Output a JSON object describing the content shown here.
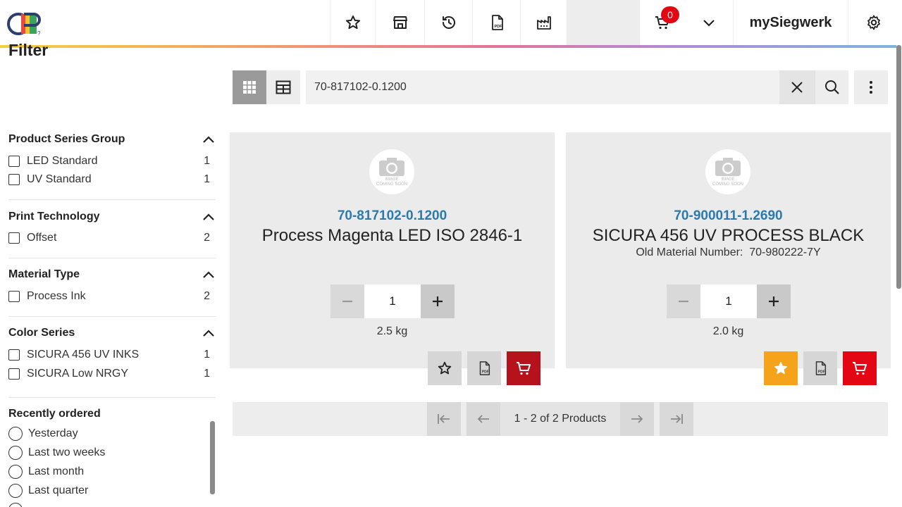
{
  "header": {
    "cart_count": "0",
    "brand": "mySiegwerk"
  },
  "sidebar": {
    "title": "Filter",
    "groups": [
      {
        "title": "Product Series Group",
        "items": [
          {
            "label": "LED Standard",
            "count": "1"
          },
          {
            "label": "UV Standard",
            "count": "1"
          }
        ]
      },
      {
        "title": "Print Technology",
        "items": [
          {
            "label": "Offset",
            "count": "2"
          }
        ]
      },
      {
        "title": "Material Type",
        "items": [
          {
            "label": "Process Ink",
            "count": "2"
          }
        ]
      },
      {
        "title": "Color Series",
        "items": [
          {
            "label": "SICURA 456 UV INKS",
            "count": "1"
          },
          {
            "label": "SICURA Low NRGY",
            "count": "1"
          }
        ]
      }
    ],
    "recent": {
      "title": "Recently ordered",
      "options": [
        "Yesterday",
        "Last two weeks",
        "Last month",
        "Last quarter"
      ]
    }
  },
  "search": {
    "value": "70-817102-0.1200"
  },
  "products": [
    {
      "code": "70-817102-0.1200",
      "name": "Process Magenta LED ISO 2846-1",
      "old_material": "",
      "qty": "1",
      "unit": "2.5 kg",
      "favorite": false
    },
    {
      "code": "70-900011-1.2690",
      "name": "SICURA 456 UV PROCESS BLACK",
      "old_material": "Old Material Number:  70-980222-7Y",
      "qty": "1",
      "unit": "2.0 kg",
      "favorite": true
    }
  ],
  "pagination": {
    "info": "1 - 2 of 2 Products"
  },
  "colors": {
    "accent_blue": "#2a7ab0",
    "cart_red": "#e30613",
    "favorite_orange": "#f5a31a"
  },
  "icons": [
    "star-icon",
    "store-icon",
    "history-icon",
    "pdf-icon",
    "factory-icon",
    "cart-icon",
    "chevron-down-icon",
    "settings-icon",
    "grid-view-icon",
    "table-view-icon",
    "close-icon",
    "search-icon",
    "more-vert-icon",
    "camera-icon",
    "minus-icon",
    "plus-icon",
    "first-page-icon",
    "prev-page-icon",
    "next-page-icon",
    "last-page-icon"
  ]
}
